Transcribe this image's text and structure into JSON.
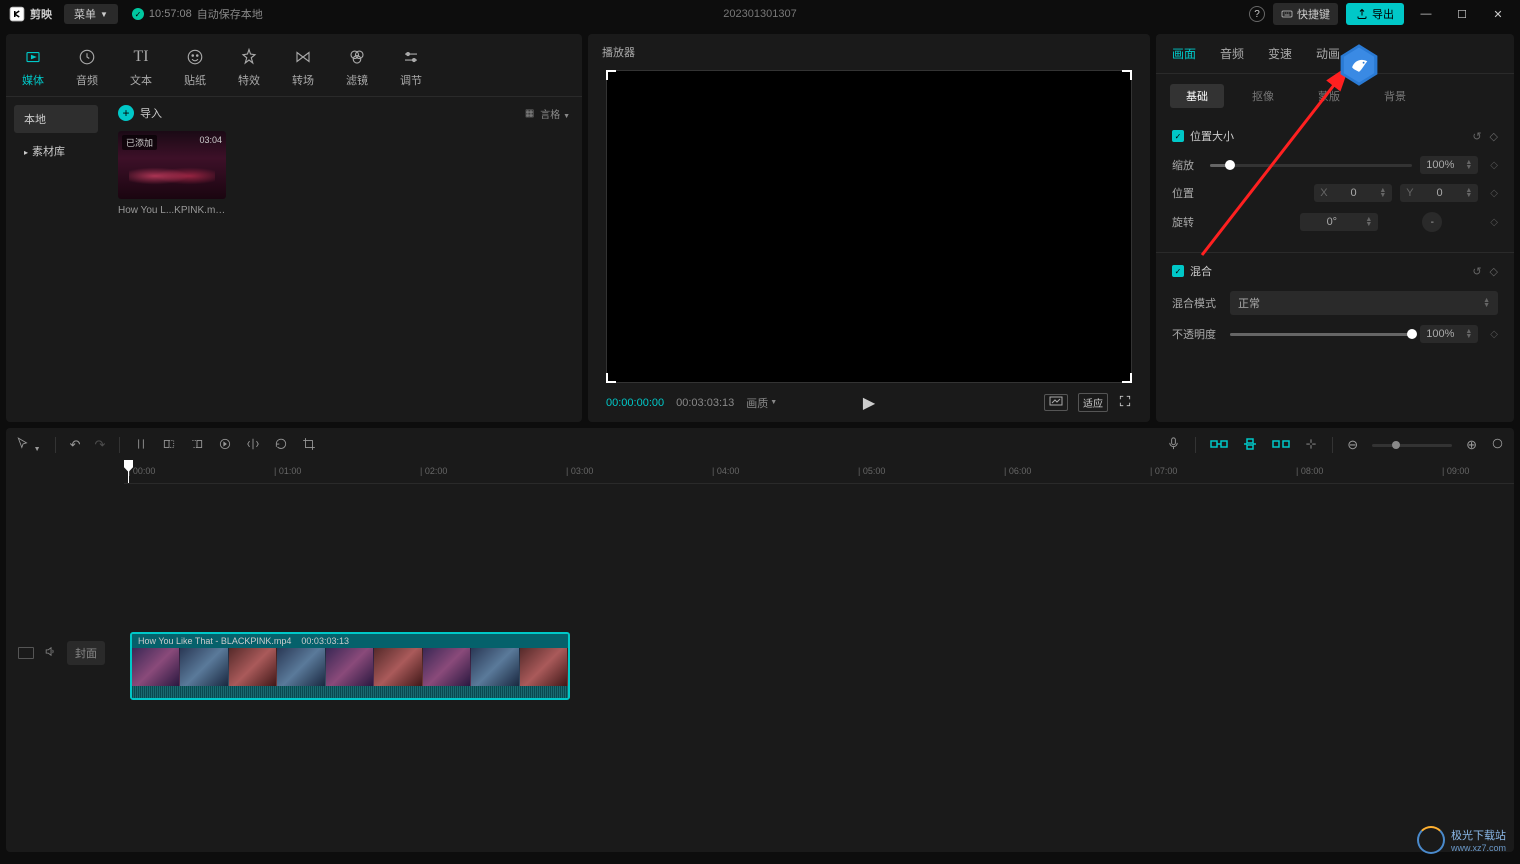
{
  "titleBar": {
    "appName": "剪映",
    "menuLabel": "菜单",
    "saveTime": "10:57:08",
    "saveText": "自动保存本地",
    "projectName": "202301301307",
    "shortcutLabel": "快捷键",
    "exportLabel": "导出"
  },
  "topTabs": [
    {
      "label": "媒体",
      "active": true
    },
    {
      "label": "音频",
      "active": false
    },
    {
      "label": "文本",
      "active": false
    },
    {
      "label": "贴纸",
      "active": false
    },
    {
      "label": "特效",
      "active": false
    },
    {
      "label": "转场",
      "active": false
    },
    {
      "label": "滤镜",
      "active": false
    },
    {
      "label": "调节",
      "active": false
    }
  ],
  "leftSidebar": {
    "local": "本地",
    "library": "素材库"
  },
  "mediaArea": {
    "importLabel": "导入",
    "styleLabel": "言格",
    "thumb": {
      "badge": "已添加",
      "duration": "03:04",
      "name": "How You L...KPINK.mp4"
    }
  },
  "player": {
    "title": "播放器",
    "currentTime": "00:00:00:00",
    "totalTime": "00:03:03:13",
    "qualityLabel": "画质",
    "fitLabel": "适应"
  },
  "inspector": {
    "tabs": [
      {
        "label": "画面",
        "active": true
      },
      {
        "label": "音频",
        "active": false
      },
      {
        "label": "变速",
        "active": false
      },
      {
        "label": "动画",
        "active": false
      }
    ],
    "subtabs": [
      {
        "label": "基础",
        "active": true
      },
      {
        "label": "抠像",
        "active": false
      },
      {
        "label": "蒙版",
        "active": false
      },
      {
        "label": "背景",
        "active": false
      }
    ],
    "positionSize": {
      "header": "位置大小",
      "scaleLabel": "缩放",
      "scaleValue": "100%",
      "positionLabel": "位置",
      "xLabel": "X",
      "xValue": "0",
      "yLabel": "Y",
      "yValue": "0",
      "rotationLabel": "旋转",
      "rotationValue": "0°"
    },
    "blend": {
      "header": "混合",
      "modeLabel": "混合模式",
      "modeValue": "正常",
      "opacityLabel": "不透明度",
      "opacityValue": "100%"
    }
  },
  "timeline": {
    "ticks": [
      "00:00",
      "01:00",
      "02:00",
      "03:00",
      "04:00",
      "05:00",
      "06:00",
      "07:00",
      "08:00",
      "09:00"
    ],
    "coverLabel": "封面",
    "clip": {
      "name": "How You Like That - BLACKPINK.mp4",
      "duration": "00:03:03:13"
    }
  },
  "watermark": {
    "name": "极光下载站",
    "url": "www.xz7.com"
  }
}
